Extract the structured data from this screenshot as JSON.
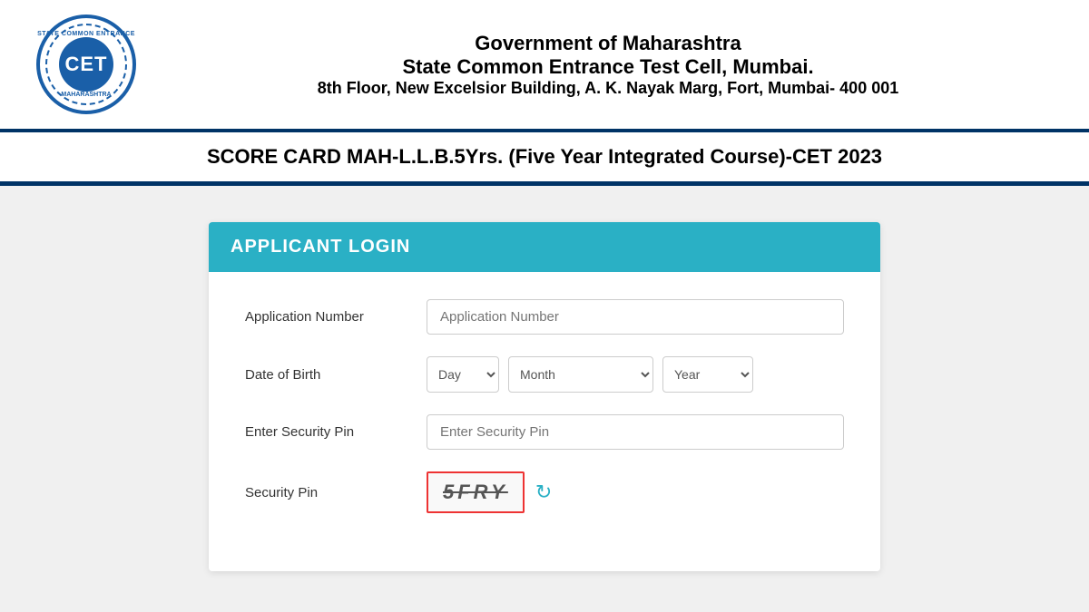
{
  "header": {
    "logo_text": "CET",
    "logo_top_text": "STATE COMMON ENTRANCE",
    "logo_bottom_text": "MAHARASHTRA",
    "line1": "Government of Maharashtra",
    "line2": "State Common Entrance Test Cell, Mumbai.",
    "line3": "8th Floor, New Excelsior Building, A. K. Nayak Marg, Fort, Mumbai- 400 001"
  },
  "title": "SCORE CARD MAH-L.L.B.5Yrs. (Five Year Integrated Course)-CET 2023",
  "card": {
    "header": "APPLICANT LOGIN",
    "fields": {
      "application_number": {
        "label": "Application Number",
        "placeholder": "Application Number"
      },
      "date_of_birth": {
        "label": "Date of Birth",
        "day_default": "Day",
        "month_default": "Month",
        "year_default": "Year"
      },
      "enter_security_pin": {
        "label": "Enter Security Pin",
        "placeholder": "Enter Security Pin"
      },
      "security_pin": {
        "label": "Security Pin",
        "captcha_value": "5FRY",
        "refresh_symbol": "↻"
      }
    }
  }
}
